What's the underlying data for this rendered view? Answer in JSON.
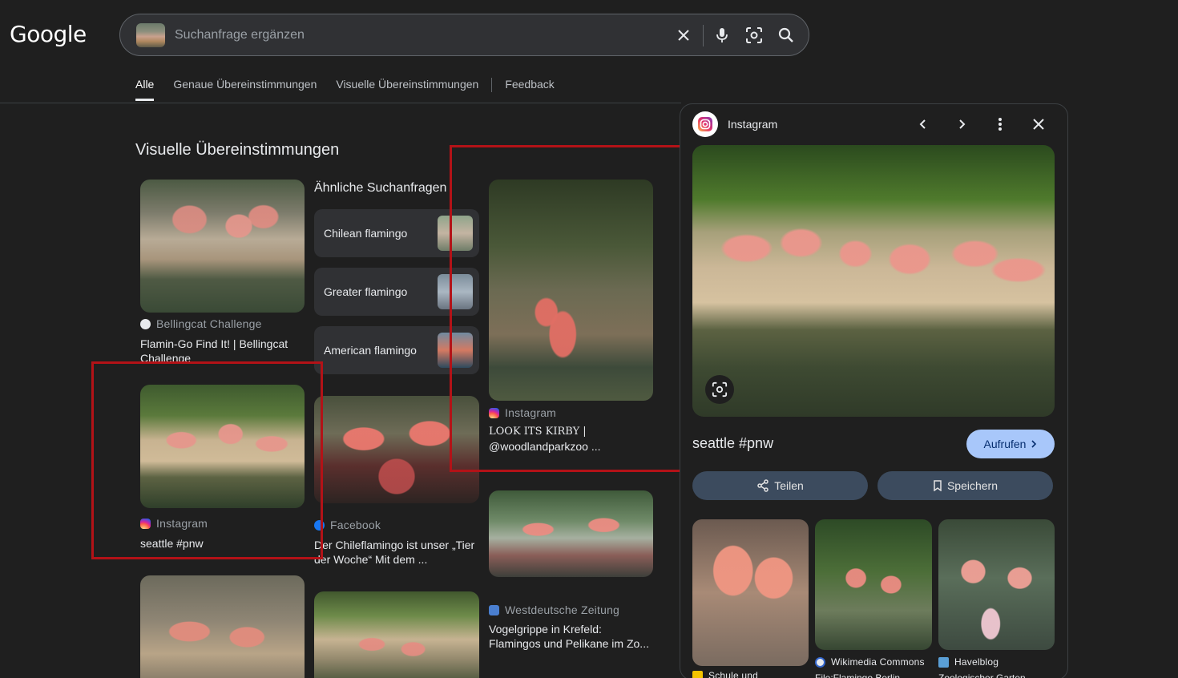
{
  "header": {
    "logo": "Google",
    "search_placeholder": "Suchanfrage ergänzen",
    "icons": [
      "close-icon",
      "microphone-icon",
      "lens-icon",
      "search-icon"
    ]
  },
  "tabs": [
    {
      "label": "Alle",
      "active": true
    },
    {
      "label": "Genaue Übereinstimmungen"
    },
    {
      "label": "Visuelle Übereinstimmungen"
    },
    {
      "label": "Feedback"
    }
  ],
  "section_title": "Visuelle Übereinstimmungen",
  "related": {
    "title": "Ähnliche Suchanfragen",
    "chips": [
      {
        "label": "Chilean flamingo"
      },
      {
        "label": "Greater flamingo"
      },
      {
        "label": "American flamingo"
      }
    ]
  },
  "results": {
    "r1": {
      "source": "Bellingcat Challenge",
      "caption": "Flamin-Go Find It! | Bellingcat Challenge"
    },
    "r2": {
      "source": "Instagram",
      "caption": "seattle #pnw"
    },
    "r3": {
      "source": "Facebook",
      "caption": "Der Chileflamingo ist unser „Tier der Woche“ Mit dem ..."
    },
    "r4": {
      "source": "Instagram",
      "caption_line1": "LOOK ITS KIRBY |",
      "caption_line2": "@woodlandparkzoo ..."
    },
    "r5": {
      "source": "Westdeutsche Zeitung",
      "caption": "Vogelgrippe in Krefeld: Flamingos und Pelikane im Zo..."
    }
  },
  "panel": {
    "source": "Instagram",
    "title": "seattle #pnw",
    "open_label": "Aufrufen",
    "share_label": "Teilen",
    "save_label": "Speichern",
    "similar": [
      {
        "source": "Schule und",
        "caption": ""
      },
      {
        "source": "Wikimedia Commons",
        "caption": "File:Flamingo Berlin"
      },
      {
        "source": "Havelblog",
        "caption": "Zoologischer Garten"
      }
    ]
  },
  "colors": {
    "accent": "#a8c7fa",
    "highlight_box": "#b31217",
    "background": "#1f1f1f"
  }
}
